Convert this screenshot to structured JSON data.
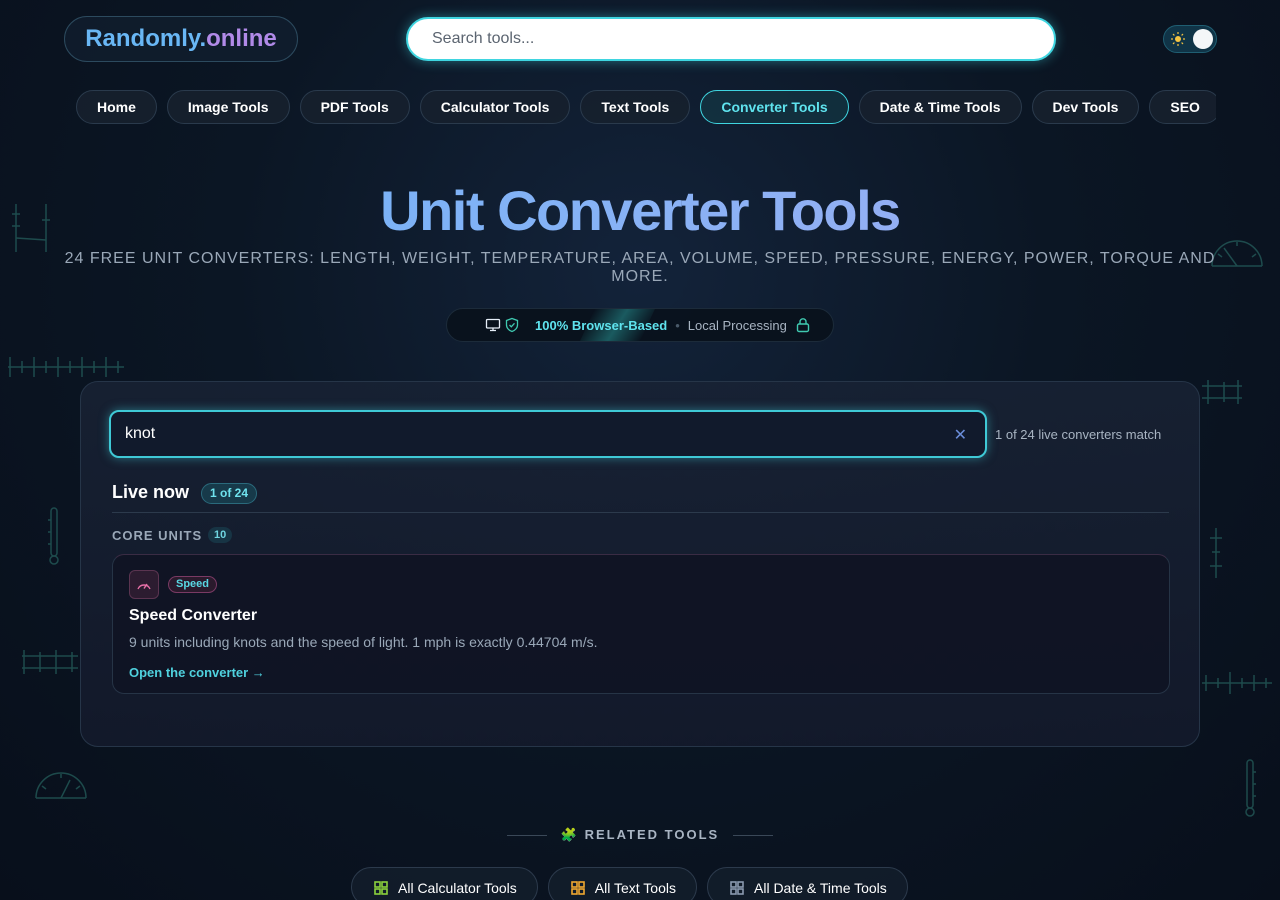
{
  "header": {
    "logo_part1": "Randomly.",
    "logo_part2": "online",
    "search_placeholder": "Search tools..."
  },
  "nav": {
    "items": [
      {
        "label": "Home",
        "active": false
      },
      {
        "label": "Image Tools",
        "active": false
      },
      {
        "label": "PDF Tools",
        "active": false
      },
      {
        "label": "Calculator Tools",
        "active": false
      },
      {
        "label": "Text Tools",
        "active": false
      },
      {
        "label": "Converter Tools",
        "active": true
      },
      {
        "label": "Date & Time Tools",
        "active": false
      },
      {
        "label": "Dev Tools",
        "active": false
      },
      {
        "label": "SEO",
        "active": false
      }
    ]
  },
  "hero": {
    "title": "Unit Converter Tools",
    "subtitle": "24 FREE UNIT CONVERTERS: LENGTH, WEIGHT, TEMPERATURE, AREA, VOLUME, SPEED, PRESSURE, ENERGY, POWER, TORQUE AND MORE.",
    "badge_primary": "100% Browser-Based",
    "badge_dot": "•",
    "badge_secondary": "Local Processing"
  },
  "filter": {
    "value": "knot",
    "clear_label": "✕",
    "match_text": "1 of 24 live converters match"
  },
  "results": {
    "title": "Live now",
    "badge": "1 of 24",
    "group_title": "CORE UNITS",
    "group_count": "10",
    "card": {
      "tag": "Speed",
      "title": "Speed Converter",
      "description": "9 units including knots and the speed of light. 1 mph is exactly 0.44704 m/s.",
      "link": "Open the converter →"
    }
  },
  "related": {
    "heading": "RELATED TOOLS",
    "icon": "🧩",
    "items": [
      {
        "label": "All Calculator Tools",
        "color": "#8cd23c"
      },
      {
        "label": "All Text Tools",
        "color": "#f0a830"
      },
      {
        "label": "All Date & Time Tools",
        "color": "#8a9ab0"
      }
    ]
  },
  "colors": {
    "accent": "#3fd5e0",
    "background": "#0b1624"
  }
}
